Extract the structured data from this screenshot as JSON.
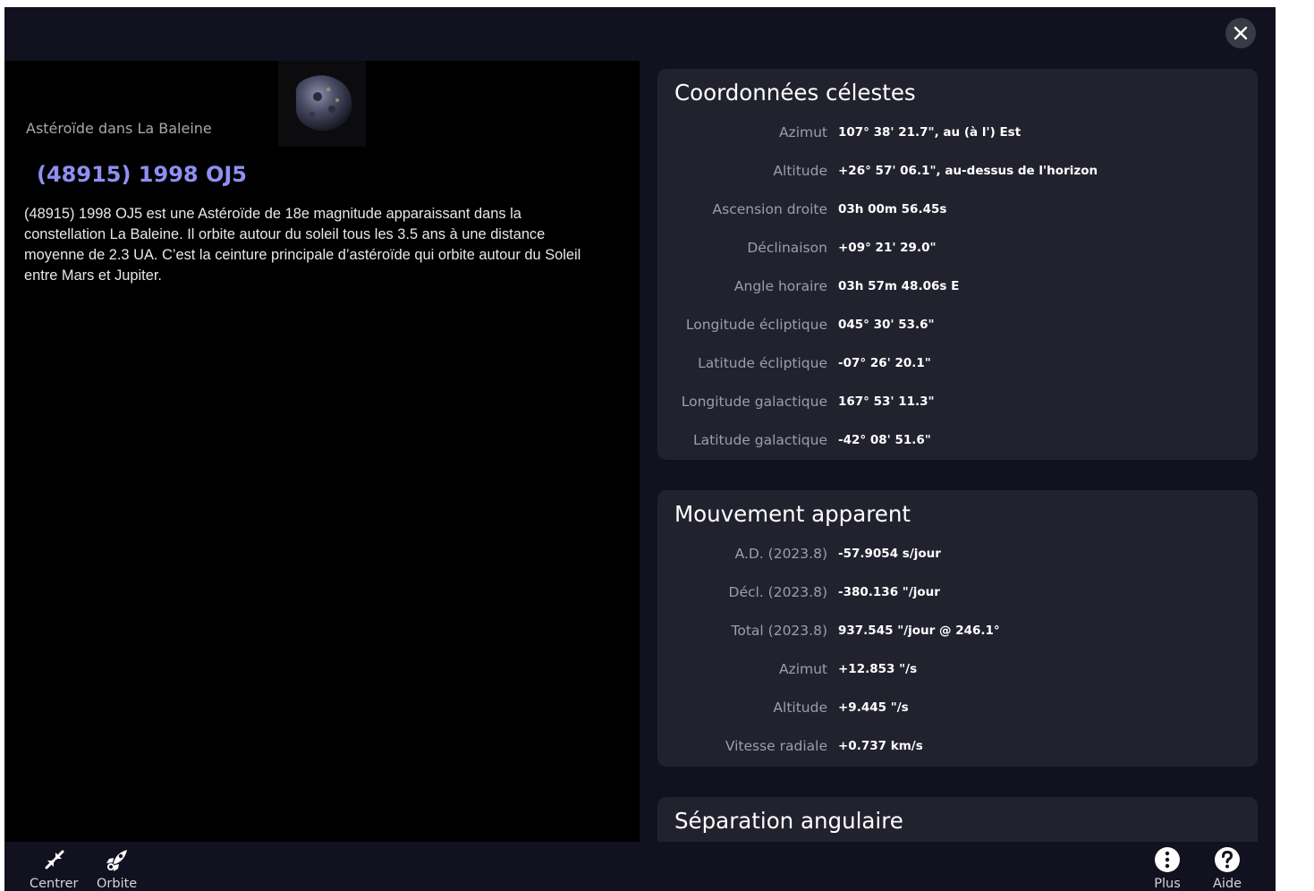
{
  "header": {
    "close_icon": "close-icon"
  },
  "object": {
    "subtitle": "Astéroïde dans La Baleine",
    "name": "(48915) 1998 OJ5",
    "description": "(48915) 1998 OJ5 est une Astéroïde de 18e magnitude apparaissant dans la constellation La Baleine. Il orbite autour du soleil tous les 3.5 ans à une distance moyenne de 2.3 UA. C’est la ceinture principale d’astéroïde qui orbite autour du Soleil entre Mars et Jupiter."
  },
  "celestial": {
    "title": "Coordonnées célestes",
    "rows": [
      {
        "label": "Azimut",
        "value": "107° 38' 21.7\", au (à l') Est"
      },
      {
        "label": "Altitude",
        "value": "+26° 57' 06.1\", au-dessus de l'horizon"
      },
      {
        "label": "Ascension droite",
        "value": "03h 00m 56.45s"
      },
      {
        "label": "Déclinaison",
        "value": "+09° 21' 29.0\""
      },
      {
        "label": "Angle horaire",
        "value": "03h 57m 48.06s E"
      },
      {
        "label": "Longitude écliptique",
        "value": "045° 30' 53.6\""
      },
      {
        "label": "Latitude écliptique",
        "value": "-07° 26' 20.1\""
      },
      {
        "label": "Longitude galactique",
        "value": "167° 53' 11.3\""
      },
      {
        "label": "Latitude galactique",
        "value": "-42° 08' 51.6\""
      }
    ]
  },
  "motion": {
    "title": "Mouvement apparent",
    "rows": [
      {
        "label": "A.D. (2023.8)",
        "value": "-57.9054 s/jour"
      },
      {
        "label": "Décl. (2023.8)",
        "value": "-380.136 \"/jour"
      },
      {
        "label": "Total (2023.8)",
        "value": "937.545 \"/jour @ 246.1°"
      },
      {
        "label": "Azimut",
        "value": "+12.853 \"/s"
      },
      {
        "label": "Altitude",
        "value": "+9.445 \"/s"
      },
      {
        "label": "Vitesse radiale",
        "value": "+0.737 km/s"
      }
    ]
  },
  "separation": {
    "title": "Séparation angulaire"
  },
  "toolbar": {
    "centrer": "Centrer",
    "orbite": "Orbite",
    "plus": "Plus",
    "aide": "Aide"
  },
  "colors": {
    "accent_title": "#8f8ff2",
    "card_bg": "#22222f",
    "app_bg": "#11111f"
  }
}
